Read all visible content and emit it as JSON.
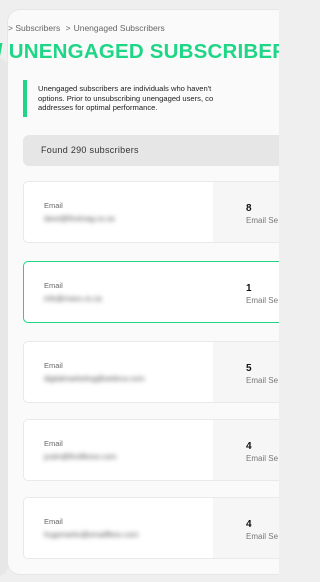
{
  "breadcrumb": {
    "prefix": ">",
    "parent": "Subscribers",
    "separator": ">",
    "current": "Unengaged Subscribers"
  },
  "page_title": "/ UNENGAGED SUBSCRIBERS",
  "info": {
    "line1": "Unengaged subscribers are individuals who haven't",
    "line2": "options. Prior to unsubscribing unengaged users, co",
    "line3": "addresses for optimal performance."
  },
  "found_text": "Found 290 subscribers",
  "rows": [
    {
      "email_label": "Email",
      "email": "dave@firstmag.co.za",
      "count": "8",
      "count_label": "Email Se"
    },
    {
      "email_label": "Email",
      "email": "info@maxx.co.za",
      "count": "1",
      "count_label": "Email Se"
    },
    {
      "email_label": "Email",
      "email": "digitalmarketing@webrux.com",
      "count": "5",
      "count_label": "Email Se"
    },
    {
      "email_label": "Email",
      "email": "justin@firstflexxx.com",
      "count": "4",
      "count_label": "Email Se"
    },
    {
      "email_label": "Email",
      "email": "hugomarks@emailflexx.com",
      "count": "4",
      "count_label": "Email Se"
    }
  ],
  "colors": {
    "accent": "#1ed686",
    "background": "#efefef",
    "card": "#fafafa"
  }
}
